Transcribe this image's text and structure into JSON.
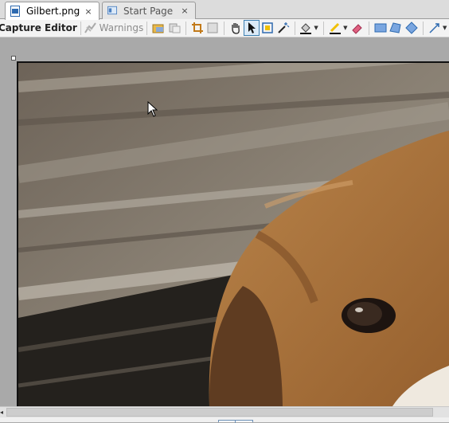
{
  "tabs": [
    {
      "label": "Gilbert.png",
      "icon": "image-file-icon",
      "close": "×",
      "active": true
    },
    {
      "label": "Start Page",
      "icon": "start-page-icon",
      "close": "×",
      "active": false
    }
  ],
  "toolbar": {
    "editor_label": "Capture Editor",
    "warnings_label": "Warnings"
  },
  "icons": {
    "pointer_glyph": "➤",
    "drop_arrow": "▼",
    "scroll_left": "◂"
  },
  "colors": {
    "selection_blue": "#3c7fb1",
    "canvas_gray": "#a9a9a9",
    "highlighter": "#f0c000",
    "eraser": "#e06080"
  }
}
